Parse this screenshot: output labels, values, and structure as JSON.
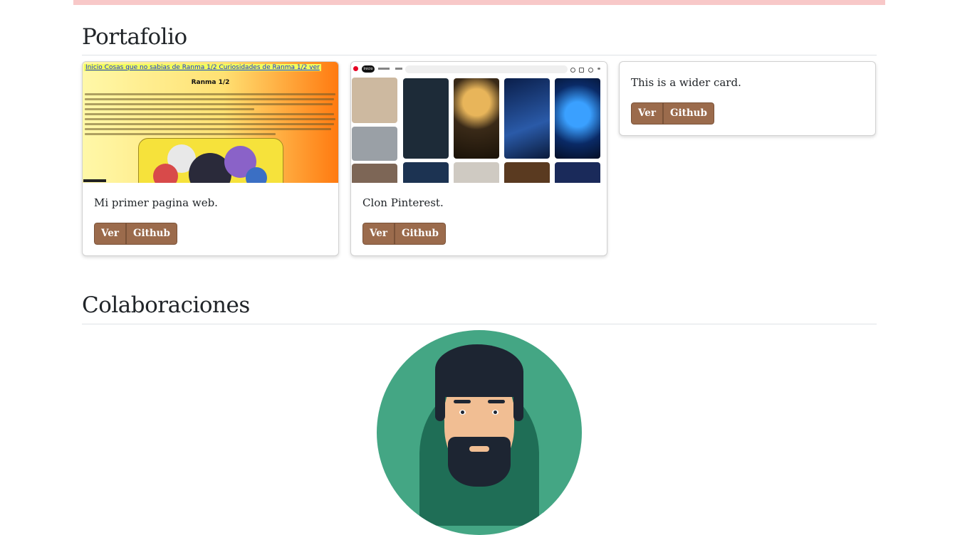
{
  "sections": {
    "portfolio_title": "Portafolio",
    "collab_title": "Colaboraciones"
  },
  "cards": [
    {
      "text": "Mi primer pagina web.",
      "view_label": "Ver",
      "github_label": "Github",
      "thumb": {
        "nav": "Inicio Cosas que no sabias de Ranma 1/2 Curiosidades de Ranma 1/2 ver",
        "heading": "Ranma 1/2"
      }
    },
    {
      "text": "Clon Pinterest.",
      "view_label": "Ver",
      "github_label": "Github",
      "thumb": {
        "home_label": "Inicio"
      }
    },
    {
      "text": "This is a wider card.",
      "view_label": "Ver",
      "github_label": "Github"
    }
  ],
  "colors": {
    "accent": "#9b6b4c",
    "top_bar": "#f8c8c8",
    "avatar_bg": "#44a684"
  }
}
